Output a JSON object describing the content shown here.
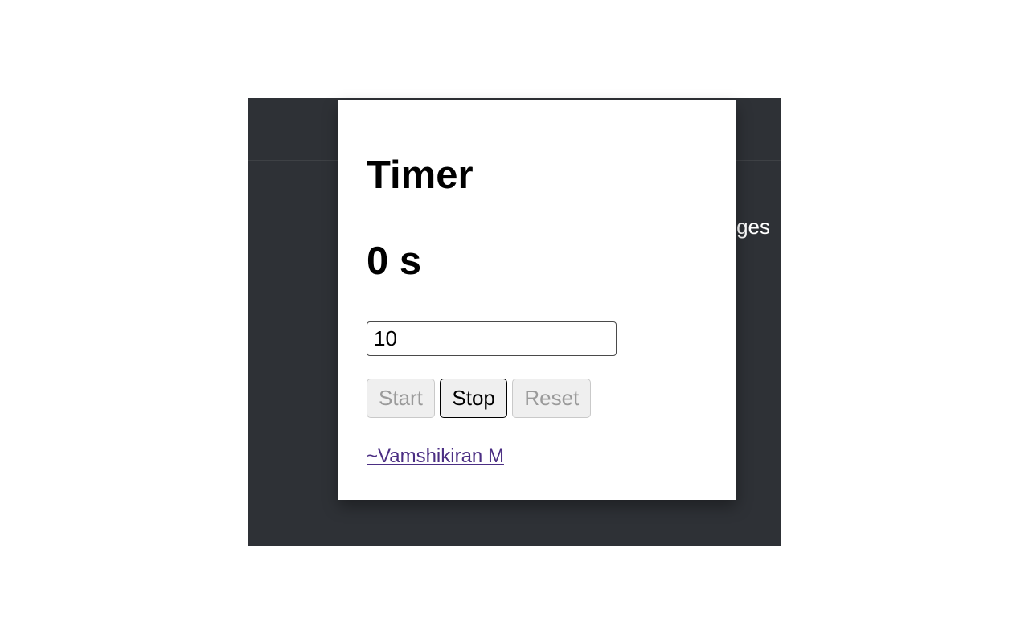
{
  "background": {
    "pages_label_partial": "ges"
  },
  "timer": {
    "title": "Timer",
    "value_display": "0 s",
    "input_value": "10",
    "buttons": {
      "start": "Start",
      "stop": "Stop",
      "reset": "Reset"
    },
    "credit": "~Vamshikiran M"
  }
}
